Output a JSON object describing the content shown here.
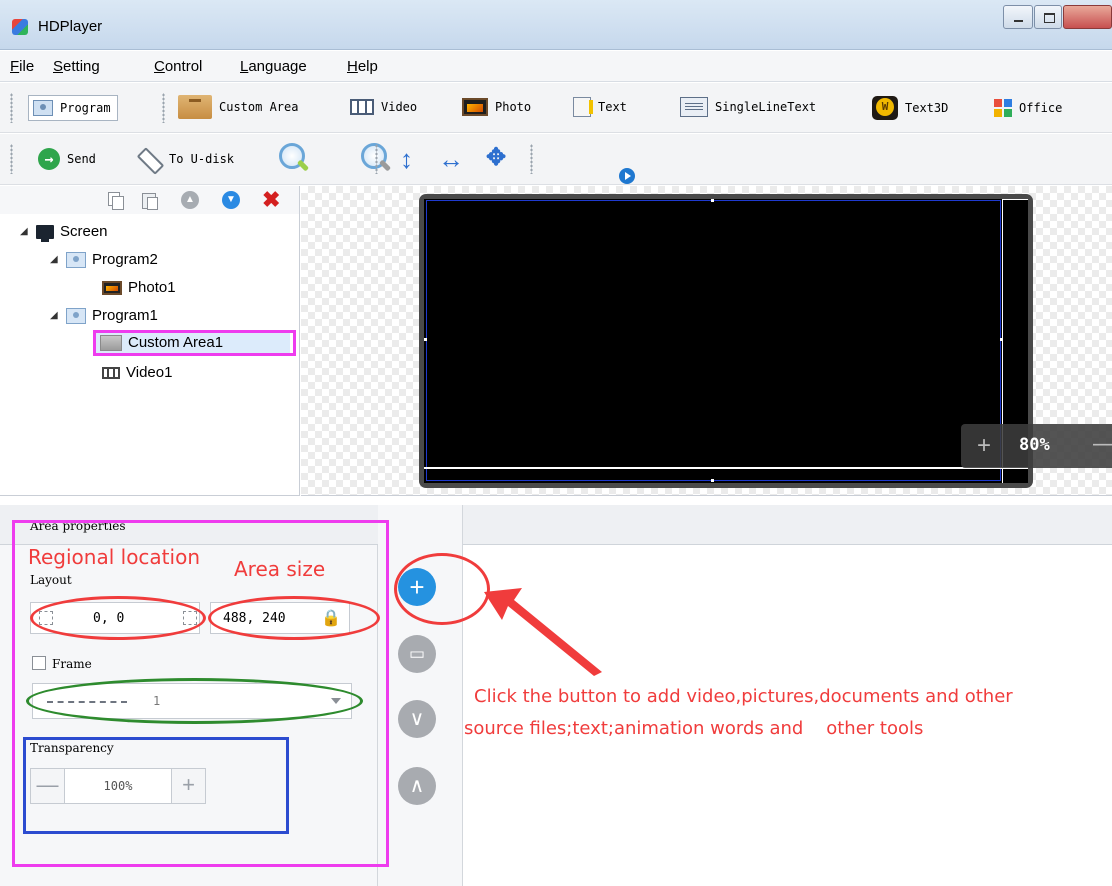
{
  "window": {
    "title": "HDPlayer",
    "app_icon": "hdplayer-logo-icon",
    "controls": [
      "minimize",
      "maximize",
      "close"
    ]
  },
  "menu": [
    "File",
    "Setting",
    "Control",
    "Language",
    "Help"
  ],
  "toolbar1": [
    {
      "label": "Program",
      "icon": "program-icon"
    },
    {
      "label": "Custom Area",
      "icon": "custom-area-icon"
    },
    {
      "label": "Video",
      "icon": "video-icon"
    },
    {
      "label": "Photo",
      "icon": "photo-icon"
    },
    {
      "label": "Text",
      "icon": "text-icon"
    },
    {
      "label": "SingleLineText",
      "icon": "single-line-text-icon"
    },
    {
      "label": "Text3D",
      "icon": "text3d-icon"
    },
    {
      "label": "Office",
      "icon": "office-icon"
    }
  ],
  "toolbar2": [
    {
      "label": "Send",
      "icon": "send-icon"
    },
    {
      "label": "To U-disk",
      "icon": "usb-icon"
    },
    {
      "label": "",
      "icon": "zoom-in-icon"
    },
    {
      "label": "",
      "icon": "zoom-out-icon"
    },
    {
      "label": "",
      "icon": "vertical-arrows-icon"
    },
    {
      "label": "",
      "icon": "horizontal-arrows-icon"
    },
    {
      "label": "",
      "icon": "move-arrows-icon"
    },
    {
      "label": "",
      "icon": "play-icon"
    }
  ],
  "tree": {
    "toolbar_icons": [
      "copy-icon",
      "paste-icon",
      "move-up-icon",
      "move-down-icon",
      "delete-icon"
    ],
    "nodes": [
      {
        "label": "Screen",
        "icon": "screen-icon",
        "level": 0,
        "expanded": true
      },
      {
        "label": "Program2",
        "icon": "program-icon",
        "level": 1,
        "expanded": true
      },
      {
        "label": "Photo1",
        "icon": "photo-icon",
        "level": 2
      },
      {
        "label": "Program1",
        "icon": "program-icon",
        "level": 1,
        "expanded": true
      },
      {
        "label": "Custom Area1",
        "icon": "custom-area-icon",
        "level": 2,
        "selected": true
      },
      {
        "label": "Video1",
        "icon": "video-icon",
        "level": 2
      }
    ]
  },
  "canvas": {
    "zoom": "80%",
    "zoom_in_label": "+",
    "zoom_out_label": "—"
  },
  "properties": {
    "title": "Area properties",
    "layout_label": "Layout",
    "position_value": "0, 0",
    "size_value": "488, 240",
    "frame_label": "Frame",
    "frame_checked": false,
    "frame_value": "1",
    "transparency_label": "Transparency",
    "transparency_value": "100%",
    "minus": "—",
    "plus": "+"
  },
  "side_buttons": [
    {
      "name": "add",
      "icon": "plus-icon",
      "glyph": "+"
    },
    {
      "name": "delete",
      "icon": "trash-icon",
      "glyph": "🗑"
    },
    {
      "name": "move-down",
      "icon": "chevron-down-icon",
      "glyph": "∨"
    },
    {
      "name": "move-up",
      "icon": "chevron-up-icon",
      "glyph": "∧"
    }
  ],
  "annotations": {
    "regional_location": "Regional location",
    "area_size": "Area size",
    "instruction_line1": "Click the button to add video,pictures,documents and other",
    "instruction_line2": "source files;text;animation words and    other tools"
  },
  "colors": {
    "annotation_red": "#f03c3c",
    "annotation_magenta": "#ee3cee",
    "annotation_green": "#2e8b2e",
    "annotation_blue": "#2c4cd0",
    "accent_blue": "#2592e0"
  }
}
